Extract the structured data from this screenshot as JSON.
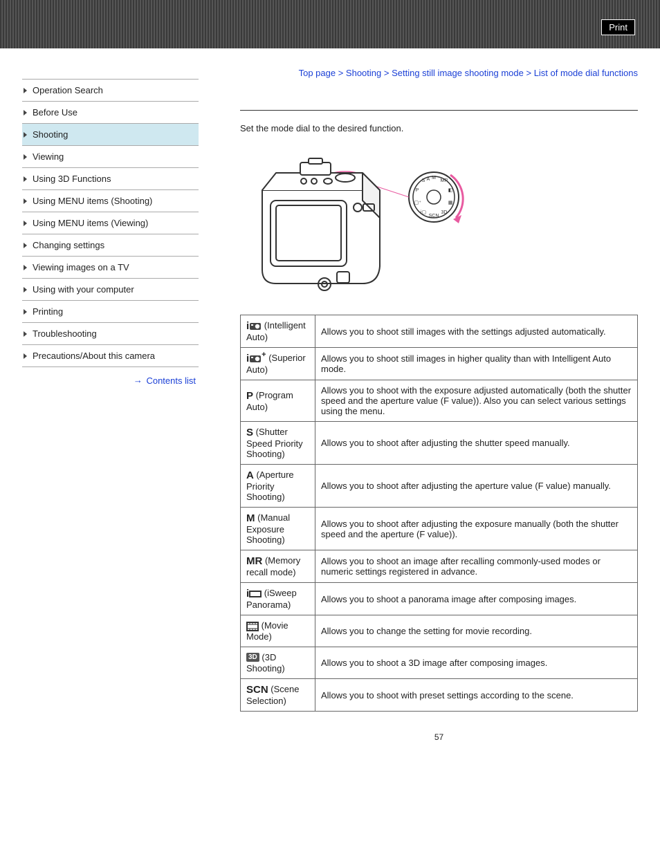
{
  "print_label": "Print",
  "sidebar": {
    "items": [
      {
        "label": "Operation Search",
        "active": false
      },
      {
        "label": "Before Use",
        "active": false
      },
      {
        "label": "Shooting",
        "active": true
      },
      {
        "label": "Viewing",
        "active": false
      },
      {
        "label": "Using 3D Functions",
        "active": false
      },
      {
        "label": "Using MENU items (Shooting)",
        "active": false
      },
      {
        "label": "Using MENU items (Viewing)",
        "active": false
      },
      {
        "label": "Changing settings",
        "active": false
      },
      {
        "label": "Viewing images on a TV",
        "active": false
      },
      {
        "label": "Using with your computer",
        "active": false
      },
      {
        "label": "Printing",
        "active": false
      },
      {
        "label": "Troubleshooting",
        "active": false
      },
      {
        "label": "Precautions/About this camera",
        "active": false
      }
    ],
    "contents_list": "Contents list"
  },
  "breadcrumb": {
    "items": [
      "Top page",
      "Shooting",
      "Setting still image shooting mode"
    ],
    "current": "List of mode dial functions",
    "sep": " > "
  },
  "intro": "Set the mode dial to the desired function.",
  "modes": [
    {
      "icon": "intelligent-auto",
      "label": " (Intelligent Auto)",
      "desc": "Allows you to shoot still images with the settings adjusted automatically."
    },
    {
      "icon": "superior-auto",
      "label": " (Superior Auto)",
      "desc": "Allows you to shoot still images in higher quality than with Intelligent Auto mode."
    },
    {
      "icon": "P",
      "label": " (Program Auto)",
      "desc": "Allows you to shoot with the exposure adjusted automatically (both the shutter speed and the aperture value (F value)). Also you can select various settings using the menu."
    },
    {
      "icon": "S",
      "label": " (Shutter Speed Priority Shooting)",
      "desc": "Allows you to shoot after adjusting the shutter speed manually."
    },
    {
      "icon": "A",
      "label": " (Aperture Priority Shooting)",
      "desc": "Allows you to shoot after adjusting the aperture value (F value) manually."
    },
    {
      "icon": "M",
      "label": " (Manual Exposure Shooting)",
      "desc": "Allows you to shoot after adjusting the exposure manually (both the shutter speed and the aperture (F value))."
    },
    {
      "icon": "MR",
      "label": " (Memory recall mode)",
      "desc": "Allows you to shoot an image after recalling commonly-used modes or numeric settings registered in advance."
    },
    {
      "icon": "isweep",
      "label": " (iSweep Panorama)",
      "desc": "Allows you to shoot a panorama image after composing images."
    },
    {
      "icon": "movie",
      "label": " (Movie Mode)",
      "desc": "Allows you to change the setting for movie recording."
    },
    {
      "icon": "3D",
      "label": " (3D Shooting)",
      "desc": "Allows you to shoot a 3D image after composing images."
    },
    {
      "icon": "SCN",
      "label": " (Scene Selection)",
      "desc": "Allows you to shoot with preset settings according to the scene."
    }
  ],
  "page_number": "57"
}
